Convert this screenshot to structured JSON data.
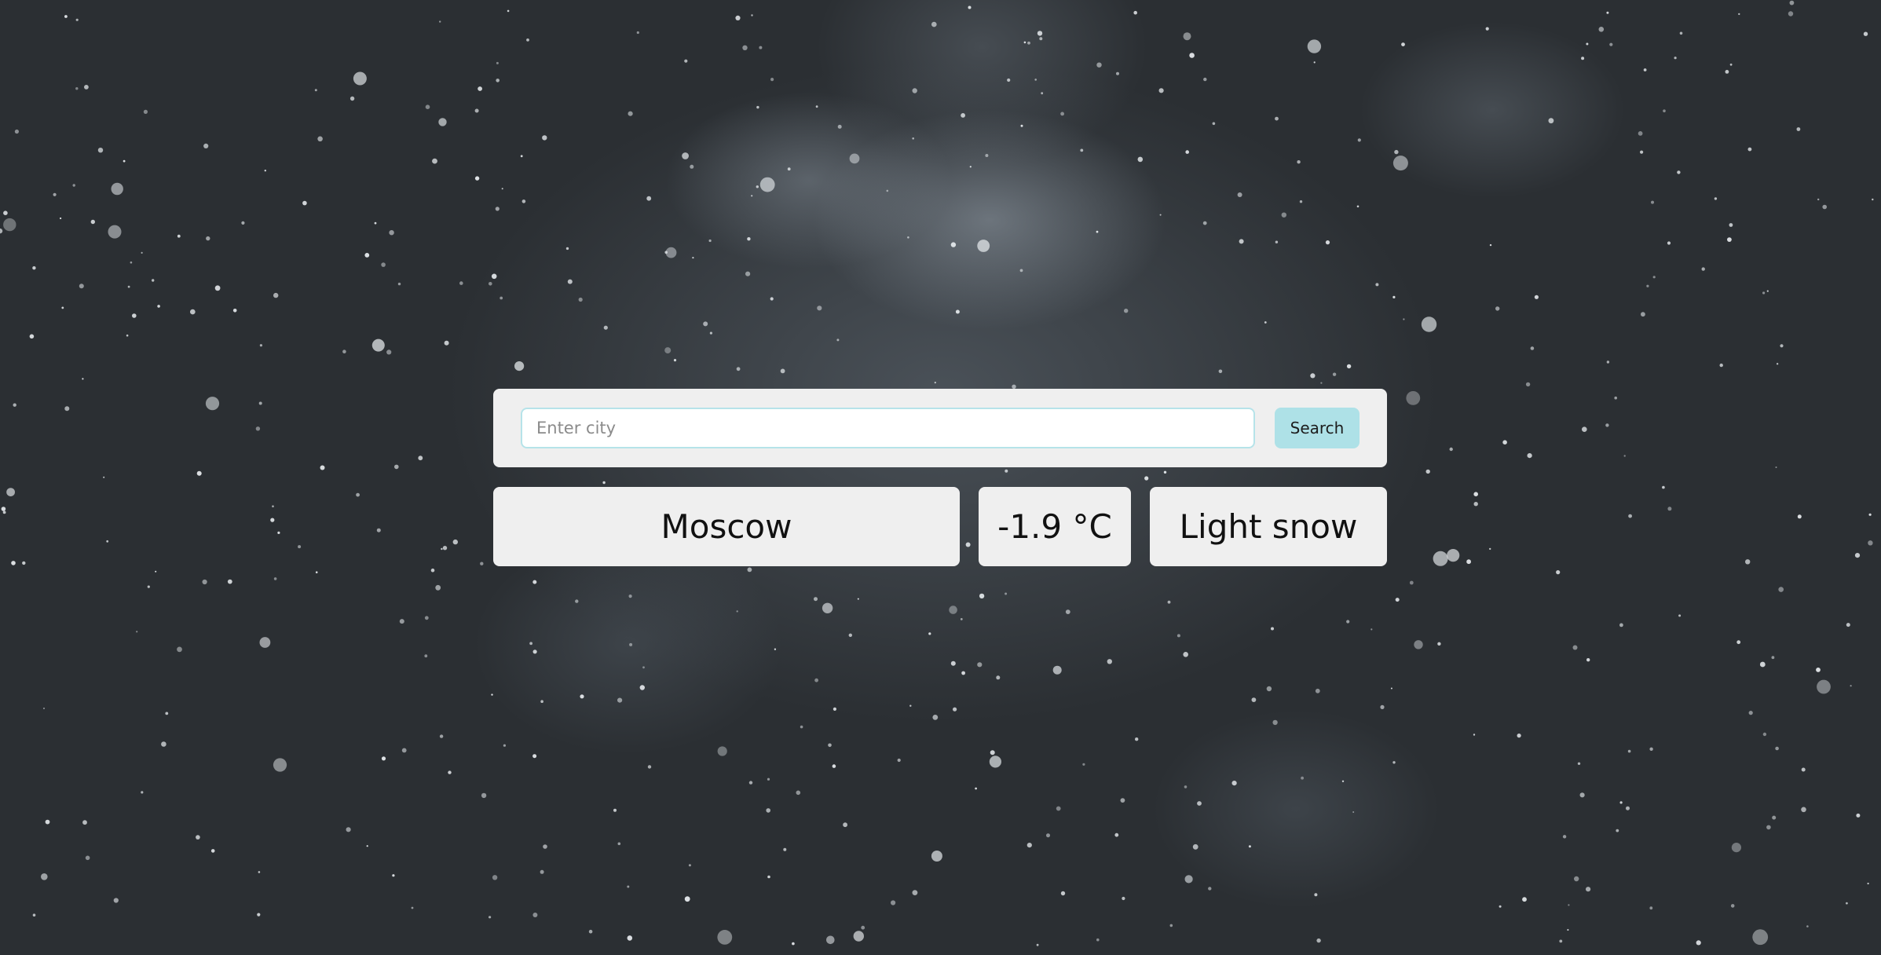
{
  "search": {
    "placeholder": "Enter city",
    "value": "",
    "button_label": "Search"
  },
  "weather": {
    "city": "Moscow",
    "temperature": "-1.9 °C",
    "condition": "Light snow"
  },
  "colors": {
    "panel_background": "#efefef",
    "button_accent": "#aee1e7",
    "input_border": "#b6e3e9"
  }
}
